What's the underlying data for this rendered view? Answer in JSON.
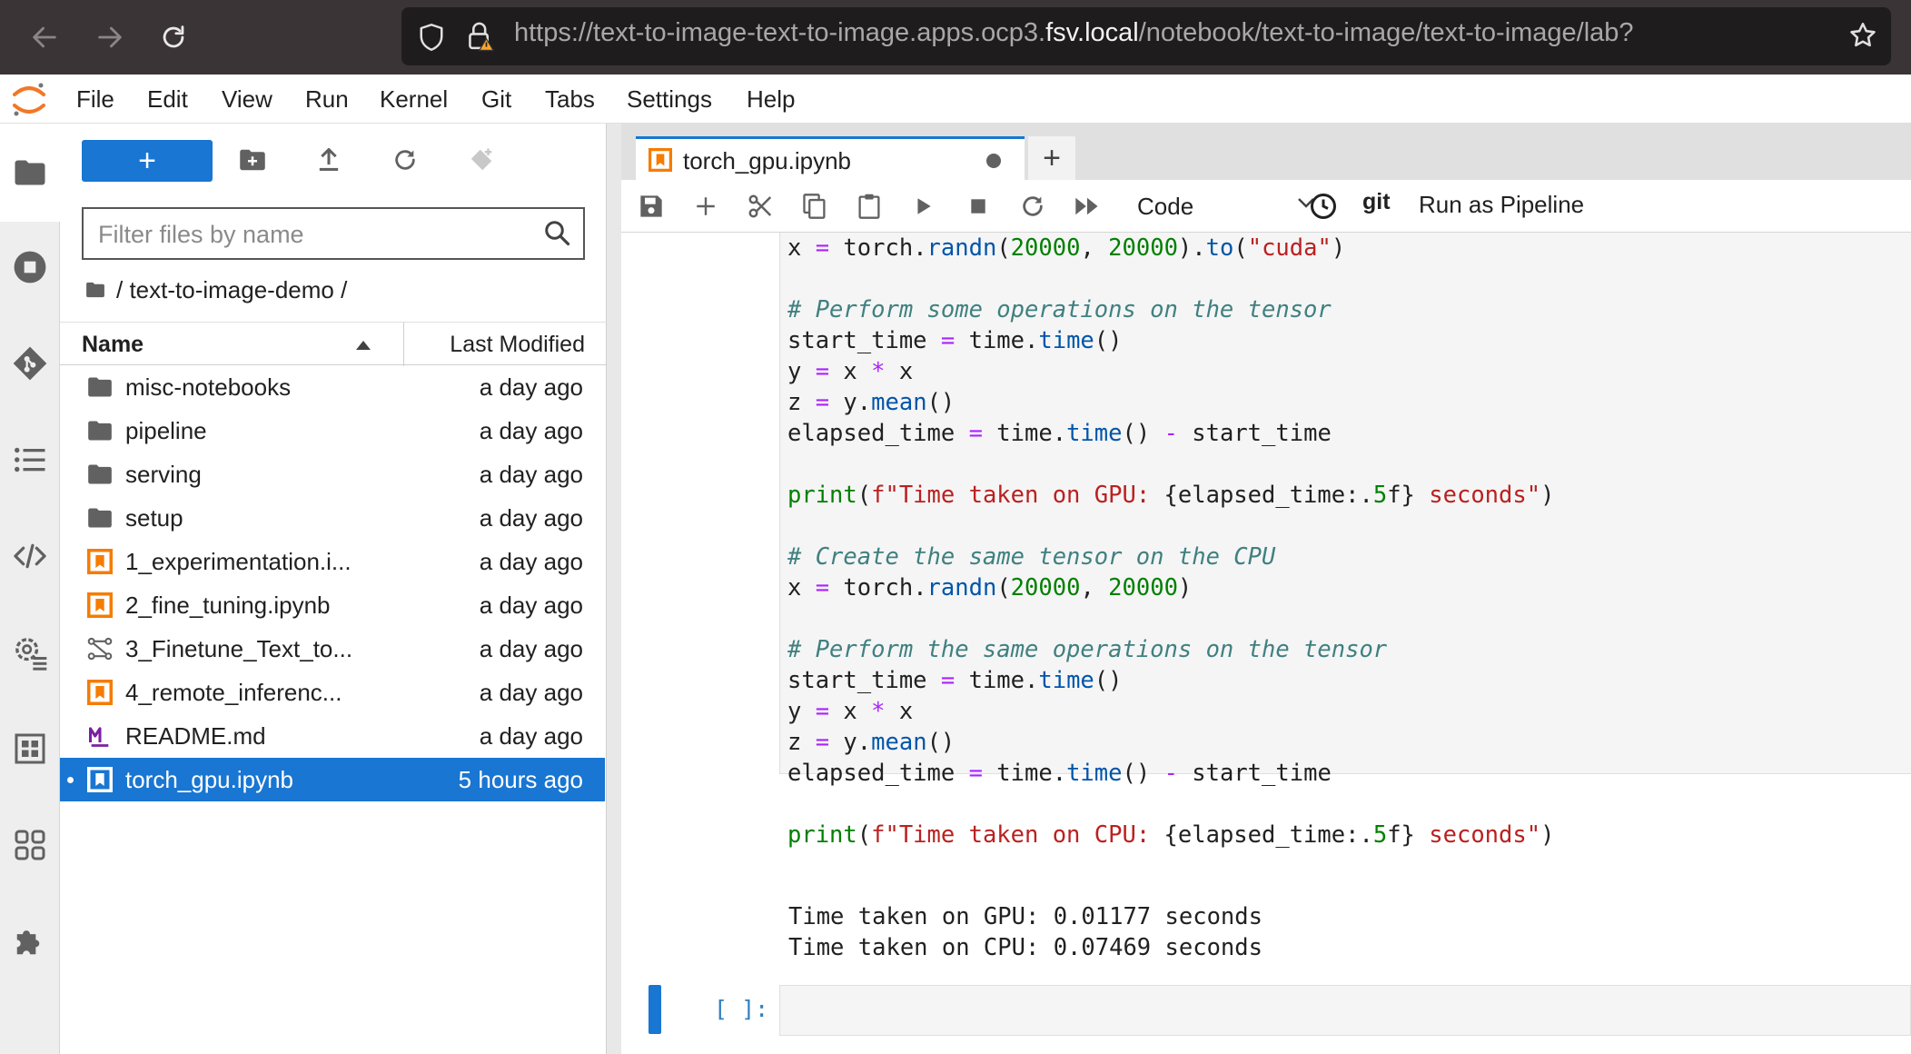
{
  "browser": {
    "url_prefix": "https://text-to-image-text-to-image.apps.ocp3.",
    "url_domain": "fsv.local",
    "url_suffix": "/notebook/text-to-image/text-to-image/lab?"
  },
  "menu": [
    "File",
    "Edit",
    "View",
    "Run",
    "Kernel",
    "Git",
    "Tabs",
    "Settings",
    "Help"
  ],
  "file_browser": {
    "new_button_label": "+",
    "filter_placeholder": "Filter files by name",
    "breadcrumb": "/ text-to-image-demo /",
    "header_name": "Name",
    "header_modified": "Last Modified",
    "files": [
      {
        "name": "misc-notebooks",
        "modified": "a day ago",
        "icon": "folder-icon"
      },
      {
        "name": "pipeline",
        "modified": "a day ago",
        "icon": "folder-icon"
      },
      {
        "name": "serving",
        "modified": "a day ago",
        "icon": "folder-icon"
      },
      {
        "name": "setup",
        "modified": "a day ago",
        "icon": "folder-icon"
      },
      {
        "name": "1_experimentation.i...",
        "modified": "a day ago",
        "icon": "notebook-icon"
      },
      {
        "name": "2_fine_tuning.ipynb",
        "modified": "a day ago",
        "icon": "notebook-icon"
      },
      {
        "name": "3_Finetune_Text_to...",
        "modified": "a day ago",
        "icon": "pipeline-icon"
      },
      {
        "name": "4_remote_inferenc...",
        "modified": "a day ago",
        "icon": "notebook-icon"
      },
      {
        "name": "README.md",
        "modified": "a day ago",
        "icon": "markdown-icon"
      },
      {
        "name": "torch_gpu.ipynb",
        "modified": "5 hours ago",
        "icon": "notebook-icon",
        "selected": true
      }
    ]
  },
  "notebook": {
    "tab_title": "torch_gpu.ipynb",
    "new_tab": "+",
    "cell_type": "Code",
    "git_label": "git",
    "pipeline_label": "Run as Pipeline",
    "empty_prompt": "[ ]:",
    "outputs": [
      "Time taken on GPU: 0.01177 seconds",
      "Time taken on CPU: 0.07469 seconds"
    ]
  },
  "colors": {
    "accent": "#1976d2",
    "browser_bg": "#3a3437",
    "notebook_orange": "#f57c00",
    "markdown_purple": "#7b1fa2"
  }
}
